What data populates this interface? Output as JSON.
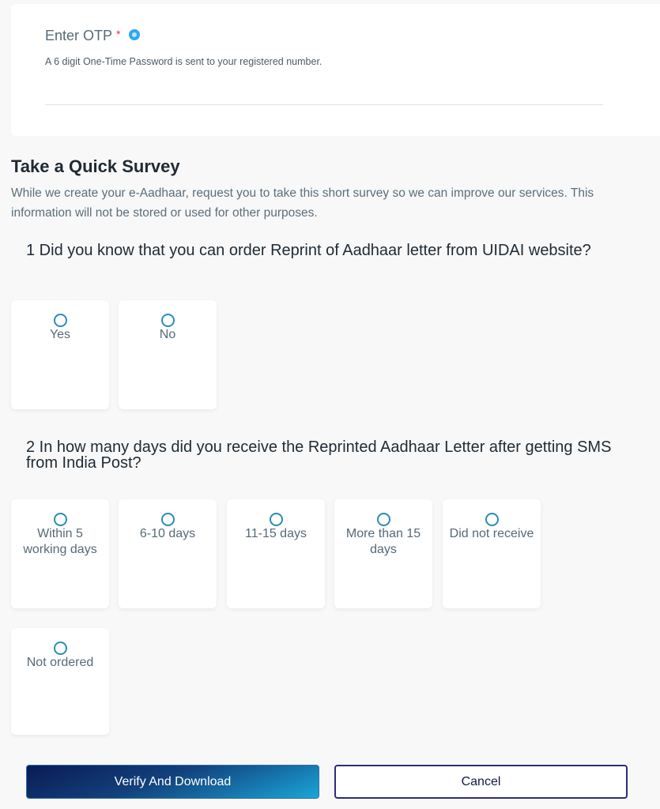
{
  "otp": {
    "label": "Enter OTP",
    "required_marker": "*",
    "info_icon": "info-icon",
    "hint": "A 6 digit One-Time Password is sent to your registered number.",
    "value": "",
    "placeholder": ""
  },
  "survey": {
    "title": "Take a Quick Survey",
    "description": "While we create your e-Aadhaar, request you to take this short survey so we can improve our services. This information will not be stored or used for other purposes.",
    "questions": [
      {
        "text": "1 Did you know that you can order Reprint of Aadhaar letter from UIDAI website?",
        "options": [
          {
            "label": "Yes",
            "selected": false
          },
          {
            "label": "No",
            "selected": false
          }
        ]
      },
      {
        "text": "2 In how many days did you receive the Reprinted Aadhaar Letter after getting SMS from India Post?",
        "options": [
          {
            "label": "Within 5 working days",
            "selected": false
          },
          {
            "label": "6-10 days",
            "selected": false
          },
          {
            "label": "11-15 days",
            "selected": false
          },
          {
            "label": "More than 15 days",
            "selected": false
          },
          {
            "label": "Did not receive",
            "selected": false
          },
          {
            "label": "Not ordered",
            "selected": false
          }
        ]
      }
    ]
  },
  "actions": {
    "verify_label": "Verify And Download",
    "cancel_label": "Cancel"
  },
  "colors": {
    "accent": "#2a8db5",
    "required": "#e53935",
    "info": "#2fa8ee",
    "primary_gradient_start": "#0b1a55",
    "primary_gradient_end": "#1aa6d8",
    "cancel_border": "#2e2b7a"
  }
}
